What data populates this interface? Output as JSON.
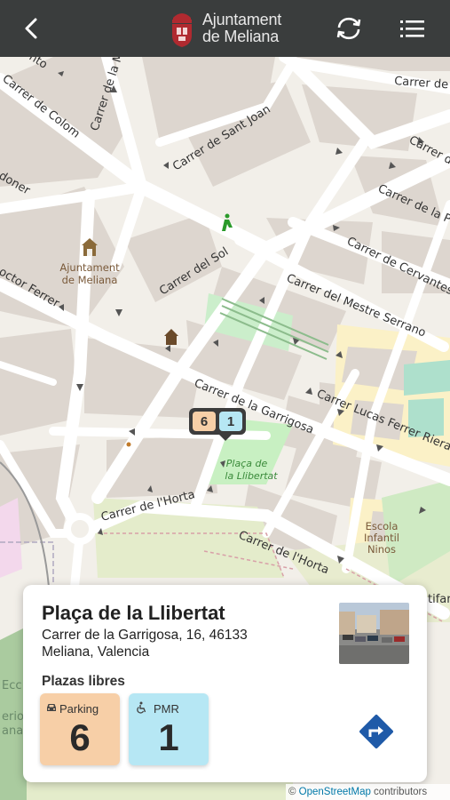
{
  "header": {
    "logo_line1": "Ajuntament",
    "logo_line2": "de Meliana",
    "back_icon": "back-arrow-icon",
    "sync_icon": "refresh-icon",
    "menu_icon": "list-menu-icon"
  },
  "map": {
    "streets": [
      "Carrer de Colom",
      "Carrer de Sant Joan",
      "Carrer del Sol",
      "Carrer de la Garrigosa",
      "Carrer del Mestre Serrano",
      "Carrer de Cervantes",
      "Carrer Lucas Ferrer Riera",
      "Carrer de l'Horta",
      "Carrer de l'Horta",
      "Carrer de la P",
      "Carrer de",
      "Carrer de la Mis",
      "octor Ferrer",
      "doner",
      "nto",
      "Carrer de"
    ],
    "poi_ajuntament_1": "Ajuntament",
    "poi_ajuntament_2": "de Meliana",
    "park_1": "Plaça de",
    "park_2": "la Llibertat",
    "school_1": "Escola",
    "school_2": "Infantil",
    "school_3": "Ninos",
    "edge_1": "tifar",
    "edge_2": "Ecc",
    "edge_3": "erio",
    "edge_4": "ana"
  },
  "marker": {
    "parking_count": "6",
    "pmr_count": "1"
  },
  "card": {
    "title": "Plaça de la Llibertat",
    "address_line1": "Carrer de la Garrigosa, 16, 46133",
    "address_line2": "Meliana, Valencia",
    "section_label": "Plazas libres",
    "parking_label": "Parking",
    "parking_value": "6",
    "pmr_label": "PMR",
    "pmr_value": "1",
    "route_icon": "directions-icon"
  },
  "attribution": {
    "prefix": "© ",
    "link": "OpenStreetMap",
    "suffix": " contributors"
  },
  "colors": {
    "header_bg": "#3a3d3d",
    "parking_tile": "#f7cfa7",
    "pmr_tile": "#b6e7f4",
    "route_blue": "#1f5aa8",
    "brand_red": "#b02a30"
  }
}
